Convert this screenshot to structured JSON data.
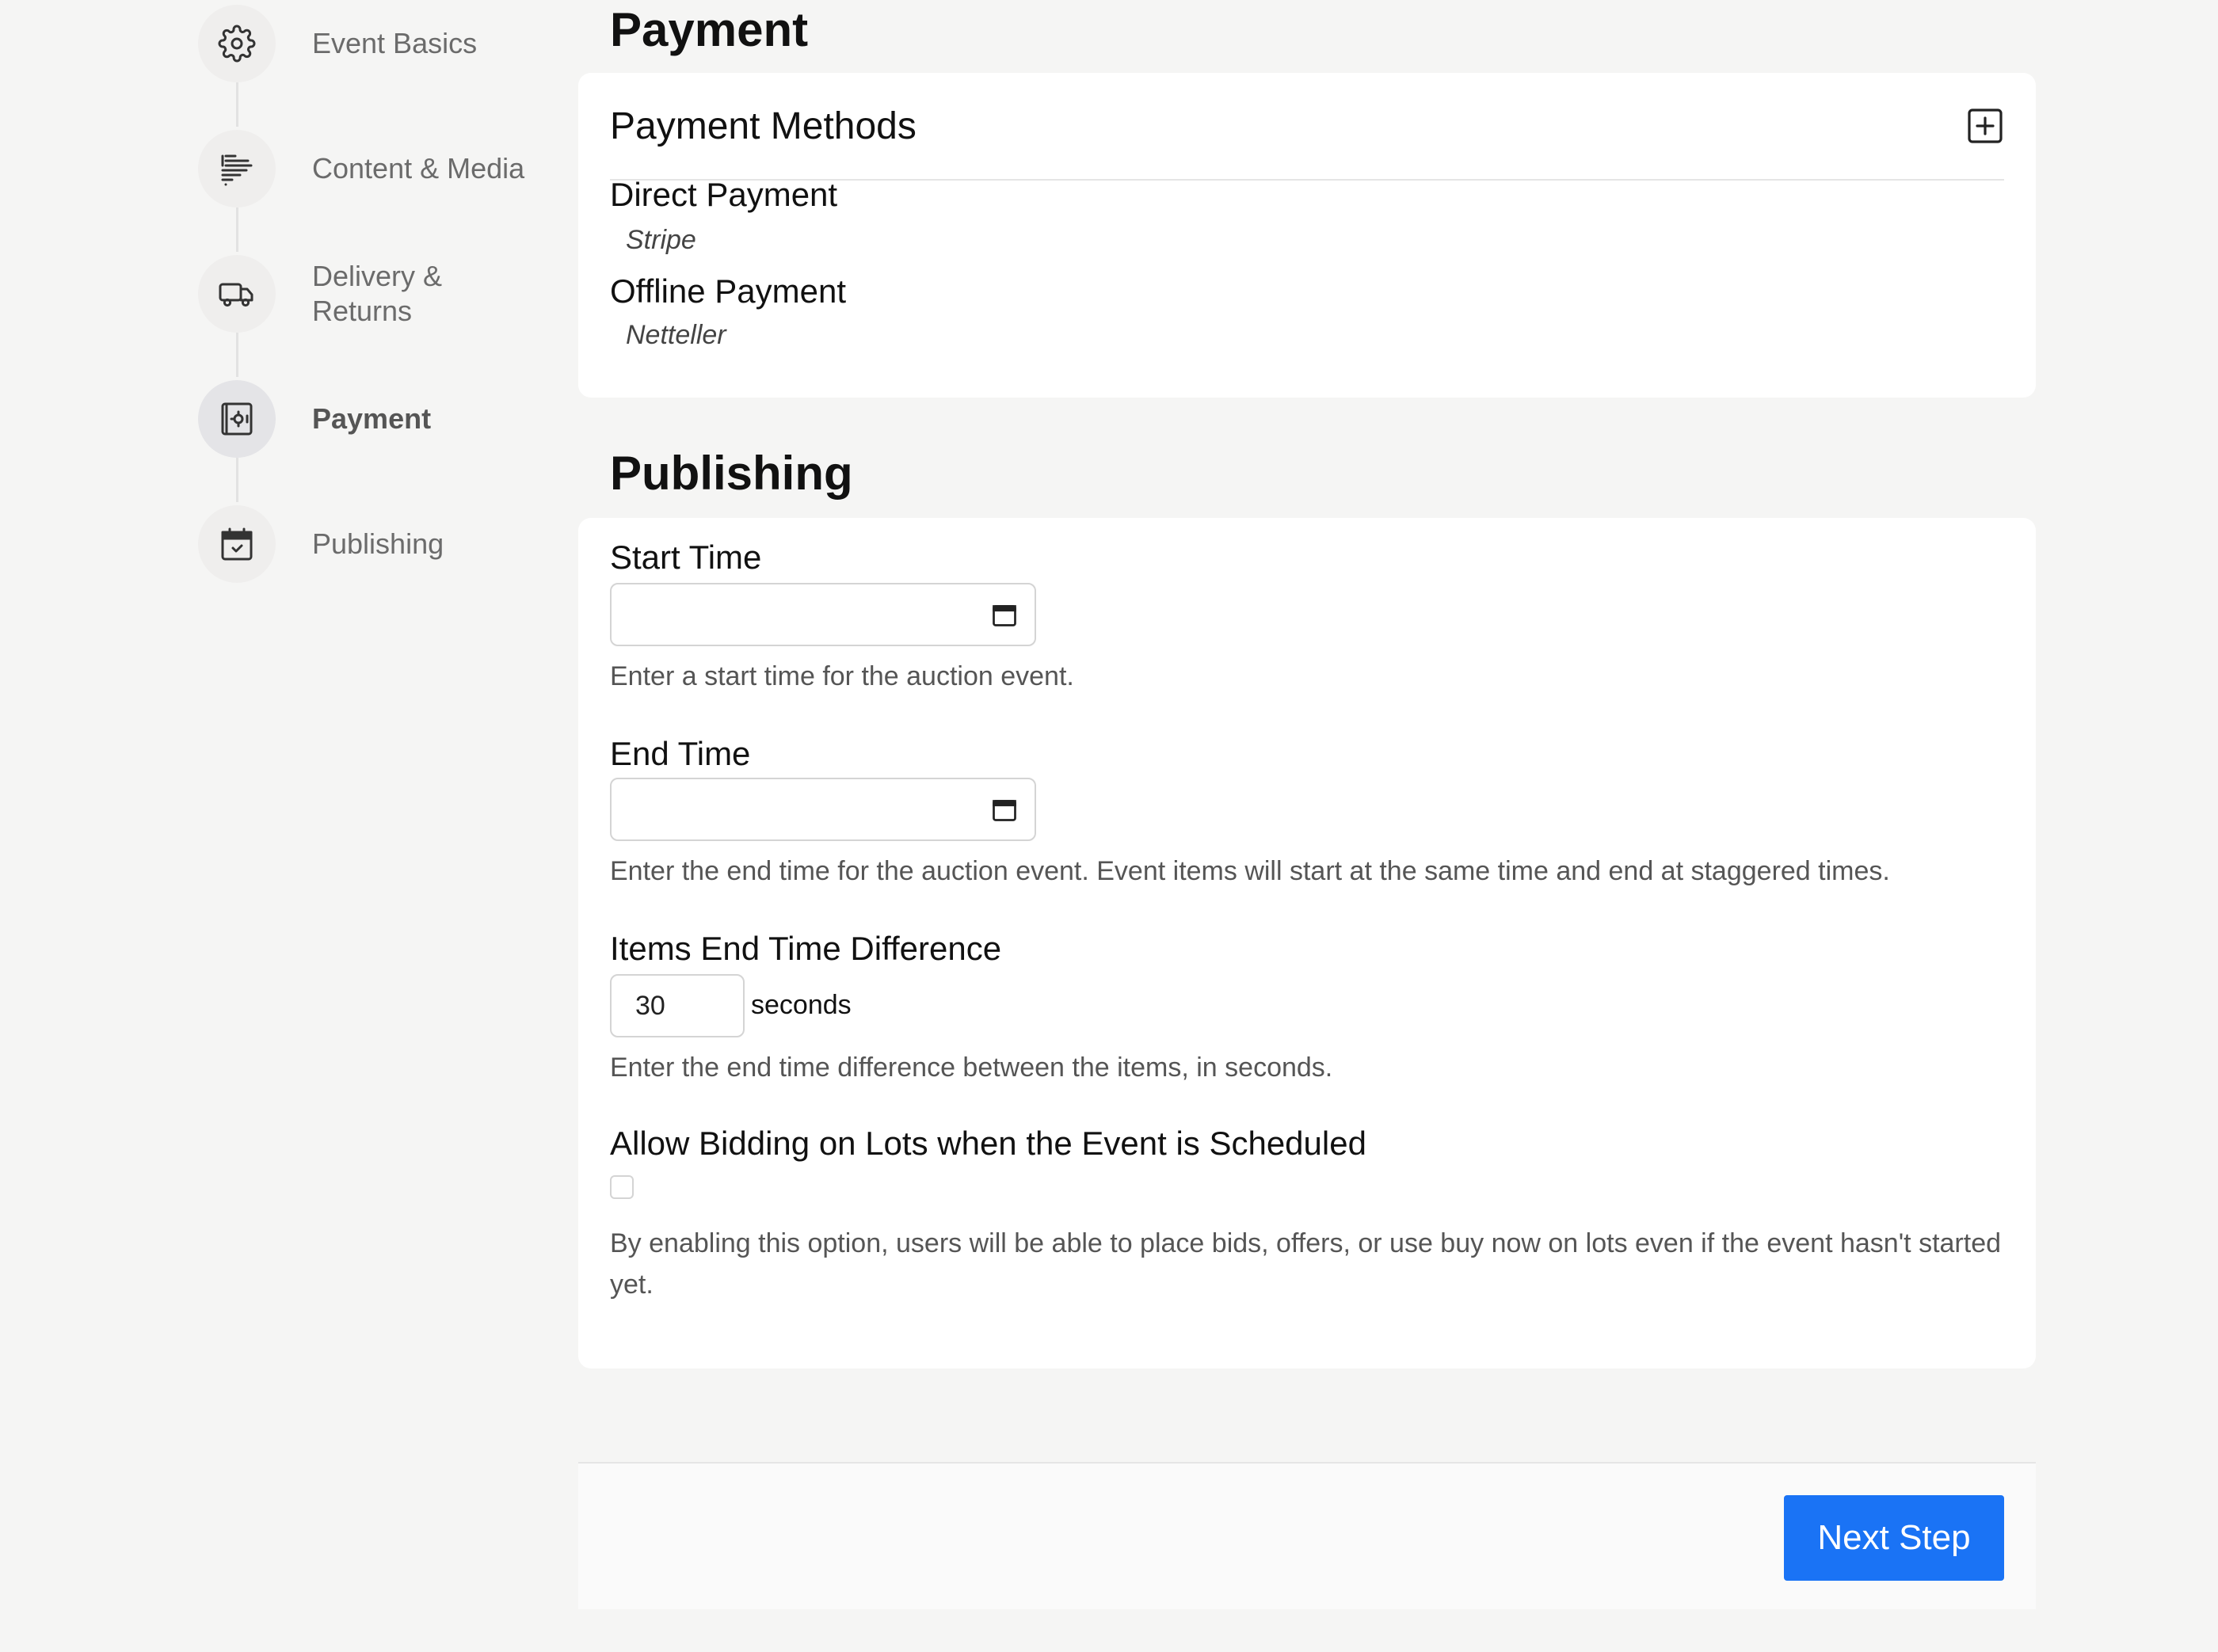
{
  "sidebar": {
    "steps": [
      {
        "label": "Event Basics",
        "icon": "gear-icon",
        "active": false
      },
      {
        "label": "Content & Media",
        "icon": "text-lines-icon",
        "active": false
      },
      {
        "label": "Delivery & Returns",
        "icon": "truck-icon",
        "active": false
      },
      {
        "label": "Payment",
        "icon": "safe-icon",
        "active": true
      },
      {
        "label": "Publishing",
        "icon": "calendar-check-icon",
        "active": false
      }
    ]
  },
  "payment": {
    "section_title": "Payment",
    "card_title": "Payment Methods",
    "add_icon": "plus-square-icon",
    "methods": [
      {
        "title": "Direct Payment",
        "provider": "Stripe"
      },
      {
        "title": "Offline Payment",
        "provider": "Netteller"
      }
    ]
  },
  "publishing": {
    "section_title": "Publishing",
    "start_time": {
      "label": "Start Time",
      "value": "",
      "icon": "calendar-icon",
      "help": "Enter a start time for the auction event."
    },
    "end_time": {
      "label": "End Time",
      "value": "",
      "icon": "calendar-icon",
      "help": "Enter the end time for the auction event. Event items will start at the same time and end at staggered times."
    },
    "items_end_diff": {
      "label": "Items End Time Difference",
      "value": "30",
      "suffix": "seconds",
      "help": "Enter the end time difference between the items, in seconds."
    },
    "allow_bidding": {
      "label": "Allow Bidding on Lots when the Event is Scheduled",
      "checked": false,
      "help": "By enabling this option, users will be able to place bids, offers, or use buy now on lots even if the event hasn't started yet."
    }
  },
  "footer": {
    "next_label": "Next Step",
    "accent_color": "#1a73f5"
  }
}
